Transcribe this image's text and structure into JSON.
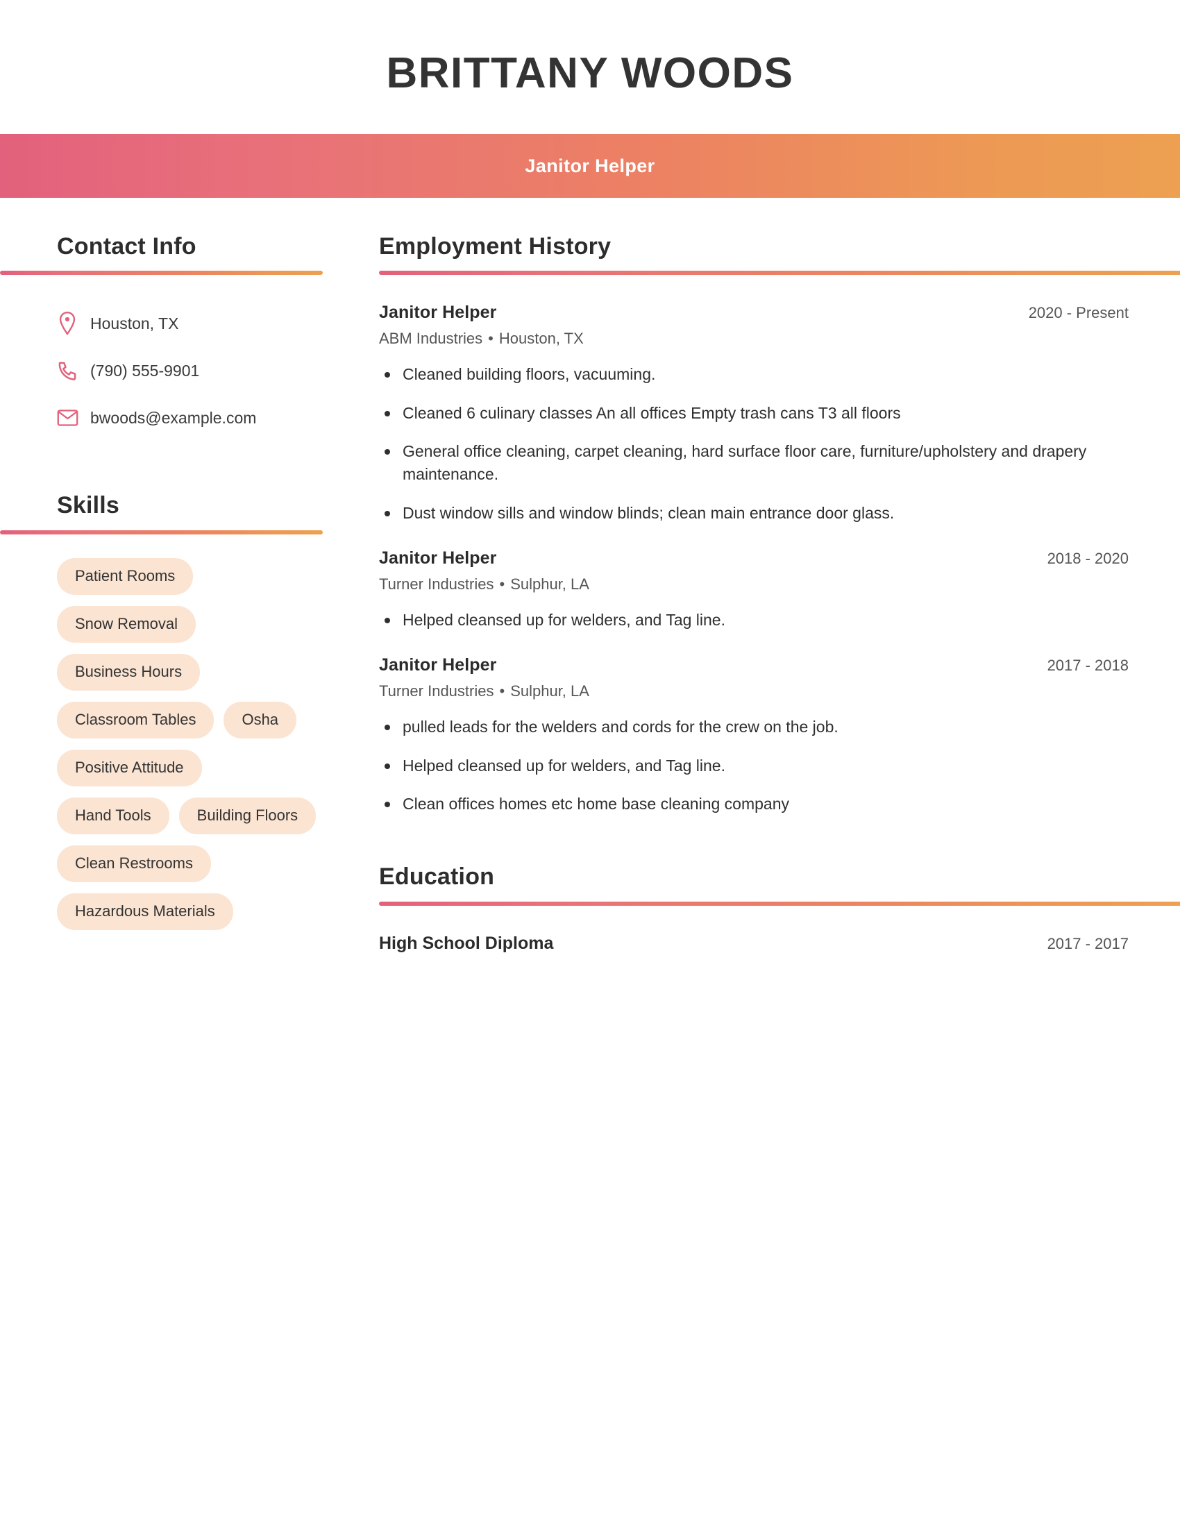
{
  "theme": {
    "gradient_start": "#e2617c",
    "gradient_end": "#eda052",
    "pill_background": "#fbe4d2",
    "heading_color": "#2d2d2d",
    "body_text_color": "#2f2f2f",
    "muted_text_color": "#565656"
  },
  "header": {
    "name": "BRITTANY WOODS",
    "subtitle": "Janitor Helper"
  },
  "contact": {
    "section_title": "Contact Info",
    "items": [
      {
        "icon": "location-pin-icon",
        "value": "Houston, TX"
      },
      {
        "icon": "phone-icon",
        "value": "(790) 555-9901"
      },
      {
        "icon": "envelope-icon",
        "value": "bwoods@example.com"
      }
    ]
  },
  "skills": {
    "section_title": "Skills",
    "items": [
      "Patient Rooms",
      "Snow Removal",
      "Business Hours",
      "Classroom Tables",
      "Osha",
      "Positive Attitude",
      "Hand Tools",
      "Building Floors",
      "Clean Restrooms",
      "Hazardous Materials"
    ]
  },
  "employment": {
    "section_title": "Employment History",
    "jobs": [
      {
        "title": "Janitor Helper",
        "dates": "2020 - Present",
        "company": "ABM Industries",
        "separator": "•",
        "location": "Houston, TX",
        "bullets": [
          "Cleaned building floors, vacuuming.",
          "Cleaned 6 culinary classes An all offices Empty trash cans T3 all floors",
          "General office cleaning, carpet cleaning, hard surface floor care, furniture/upholstery and drapery maintenance.",
          "Dust window sills and window blinds; clean main entrance door glass."
        ]
      },
      {
        "title": "Janitor Helper",
        "dates": "2018 - 2020",
        "company": "Turner Industries",
        "separator": "•",
        "location": "Sulphur, LA",
        "bullets": [
          "Helped cleansed up for welders, and Tag line."
        ]
      },
      {
        "title": "Janitor Helper",
        "dates": "2017 - 2018",
        "company": "Turner Industries",
        "separator": "•",
        "location": "Sulphur, LA",
        "bullets": [
          "pulled leads for the welders and cords for the crew on the job.",
          "Helped cleansed up for welders, and Tag line.",
          "Clean offices homes etc home base cleaning company"
        ]
      }
    ]
  },
  "education": {
    "section_title": "Education",
    "items": [
      {
        "degree": "High School Diploma",
        "dates": "2017 - 2017"
      }
    ]
  }
}
